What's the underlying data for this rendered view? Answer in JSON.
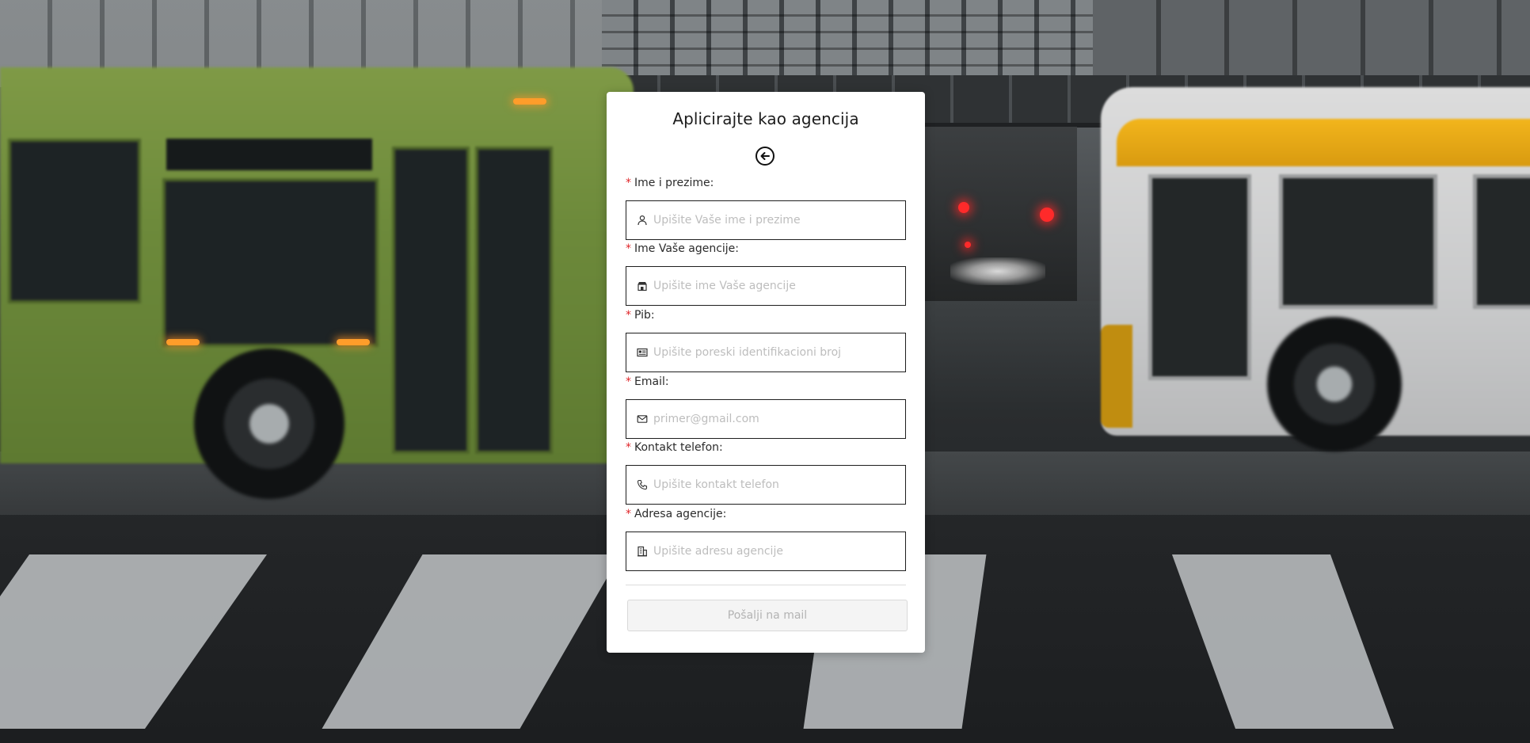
{
  "form": {
    "title": "Aplicirajte kao agencija",
    "back_icon": "arrow-left-circle-icon",
    "required_marker": "*",
    "fields": [
      {
        "label": "Ime i prezime:",
        "placeholder": "Upišite Vaše ime i prezime",
        "value": "",
        "icon": "user-icon"
      },
      {
        "label": "Ime Vaše agencije:",
        "placeholder": "Upišite ime Vaše agencije",
        "value": "",
        "icon": "shop-icon"
      },
      {
        "label": "Pib:",
        "placeholder": "Upišite poreski identifikacioni broj",
        "value": "",
        "icon": "id-card-icon"
      },
      {
        "label": "Email:",
        "placeholder": "primer@gmail.com",
        "value": "",
        "icon": "mail-icon"
      },
      {
        "label": "Kontakt telefon:",
        "placeholder": "Upišite kontakt telefon",
        "value": "",
        "icon": "phone-icon"
      },
      {
        "label": "Adresa agencije:",
        "placeholder": "Upišite adresu agencije",
        "value": "",
        "icon": "building-icon"
      }
    ],
    "submit_label": "Pošalji na mail"
  },
  "colors": {
    "required": "#e0262a",
    "input_border": "#1e1e1e",
    "placeholder": "#bdbdbd",
    "button_disabled_bg": "#f4f4f4",
    "button_disabled_text": "#b3b3b3"
  }
}
